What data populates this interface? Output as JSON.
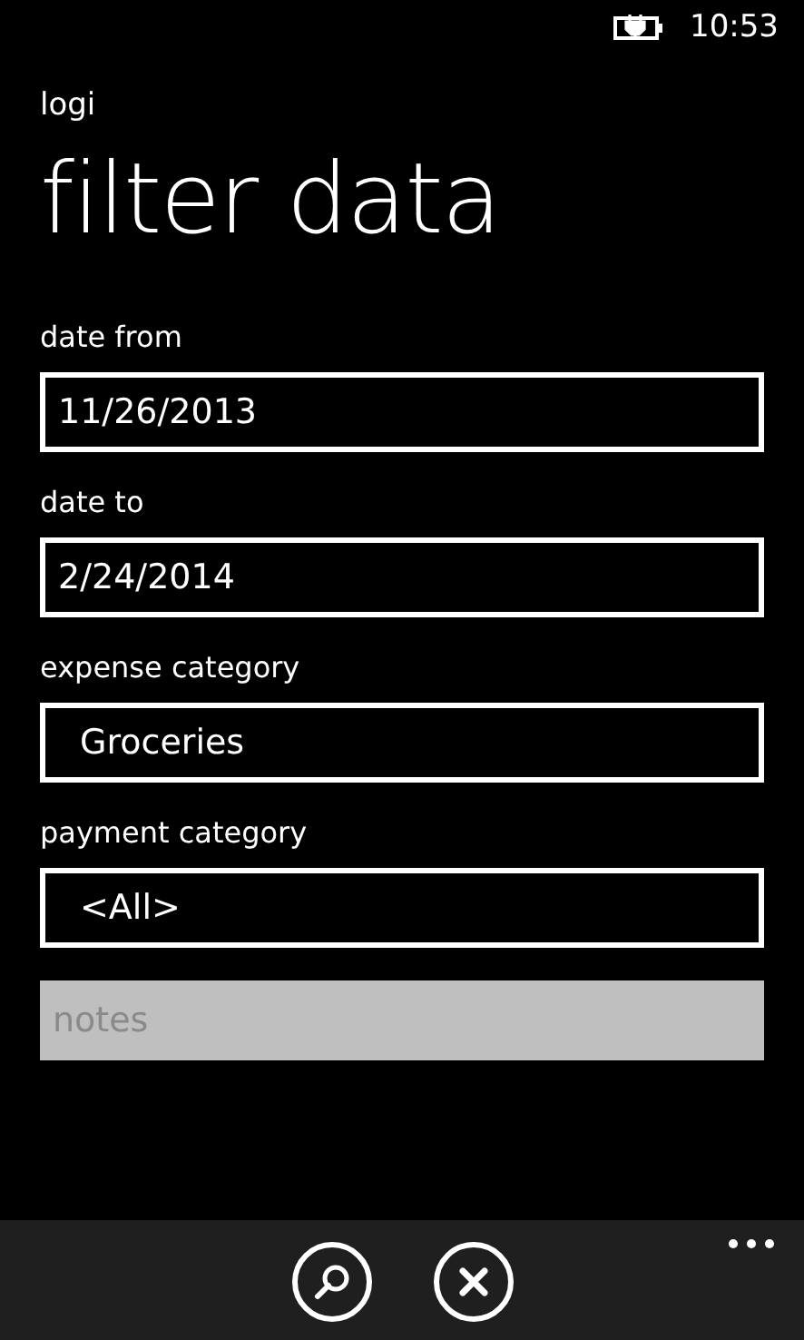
{
  "status_bar": {
    "time": "10:53"
  },
  "app_name": "logi",
  "page_title": "filter data",
  "fields": [
    {
      "kind": "text",
      "label": "date from",
      "value": "11/26/2013"
    },
    {
      "kind": "text",
      "label": "date to",
      "value": "2/24/2014"
    },
    {
      "kind": "picker",
      "label": "expense category",
      "value": "Groceries"
    },
    {
      "kind": "picker",
      "label": "payment category",
      "value": "<All>"
    },
    {
      "kind": "text",
      "placeholder": "notes"
    }
  ],
  "app_bar": {
    "buttons": [
      {
        "kind": "search"
      },
      {
        "kind": "cancel"
      }
    ]
  }
}
